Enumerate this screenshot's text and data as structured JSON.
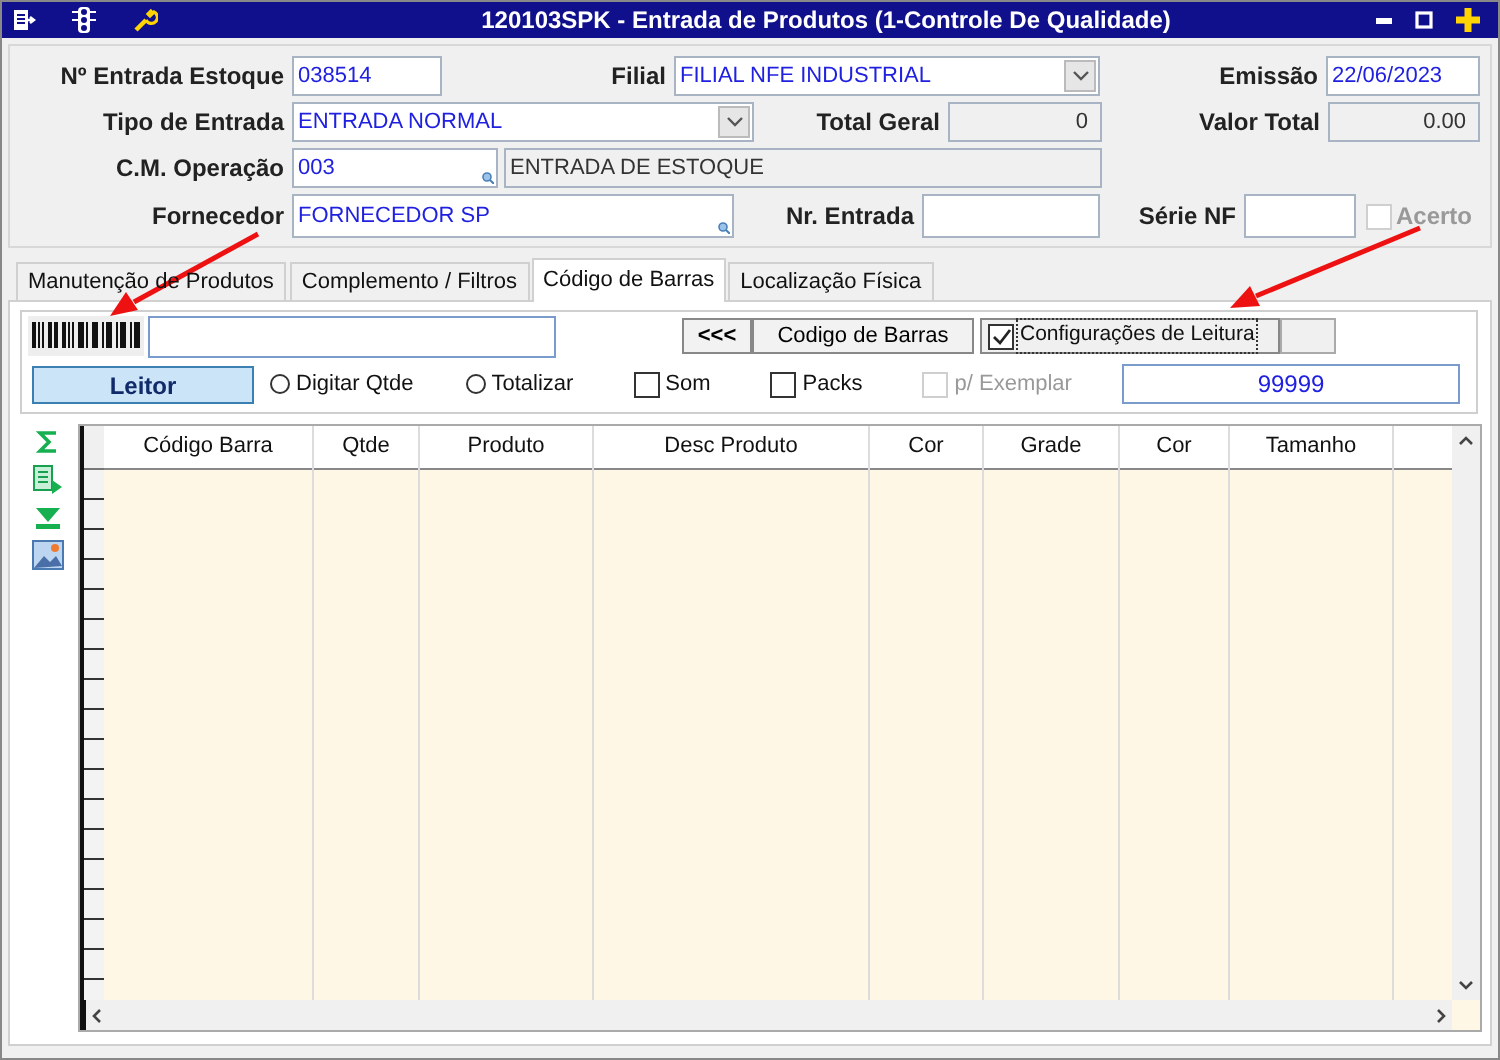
{
  "window": {
    "title": "120103SPK - Entrada de Produtos (1-Controle De Qualidade)"
  },
  "form": {
    "nr_entrada_estoque": {
      "label": "Nº Entrada Estoque",
      "value": "038514"
    },
    "filial": {
      "label": "Filial",
      "value": "FILIAL NFE INDUSTRIAL"
    },
    "emissao": {
      "label": "Emissão",
      "value": "22/06/2023"
    },
    "tipo_entrada": {
      "label": "Tipo de Entrada",
      "value": "ENTRADA NORMAL"
    },
    "total_geral": {
      "label": "Total Geral",
      "value": "0"
    },
    "cm_operacao": {
      "label": "C.M. Operação",
      "value": "003",
      "description": "ENTRADA DE ESTOQUE"
    },
    "valor_total": {
      "label": "Valor Total",
      "value": "0.00"
    },
    "fornecedor": {
      "label": "Fornecedor",
      "value": "FORNECEDOR SP"
    },
    "nr_entrada": {
      "label": "Nr. Entrada"
    },
    "serie_nf": {
      "label": "Série NF"
    },
    "acerto": {
      "label": "Acerto",
      "checked": false,
      "disabled": true
    }
  },
  "tabs": [
    {
      "label": "Manutenção de Produtos",
      "selected": false
    },
    {
      "label": "Complemento / Filtros",
      "selected": false
    },
    {
      "label": "Código de Barras",
      "selected": true
    },
    {
      "label": "Localização Física",
      "selected": false
    }
  ],
  "barcode": {
    "back_button": "<<<",
    "mode_button": "Codigo de Barras",
    "config": {
      "label": "Configurações de Leitura",
      "checked": true
    }
  },
  "options": {
    "reader_button": "Leitor",
    "items": [
      {
        "kind": "radio",
        "label": "Digitar Qtde",
        "checked": false,
        "disabled": false
      },
      {
        "kind": "radio",
        "label": "Totalizar",
        "checked": false,
        "disabled": false
      },
      {
        "kind": "checkbox",
        "label": "Som",
        "checked": false,
        "disabled": false
      },
      {
        "kind": "checkbox",
        "label": "Packs",
        "checked": false,
        "disabled": false
      },
      {
        "kind": "checkbox",
        "label": "p/ Exemplar",
        "checked": false,
        "disabled": true
      }
    ],
    "count": "99999"
  },
  "grid": {
    "columns": [
      "Código Barra",
      "Qtde",
      "Produto",
      "Desc Produto",
      "Cor",
      "Grade",
      "Cor",
      "Tamanho"
    ]
  }
}
